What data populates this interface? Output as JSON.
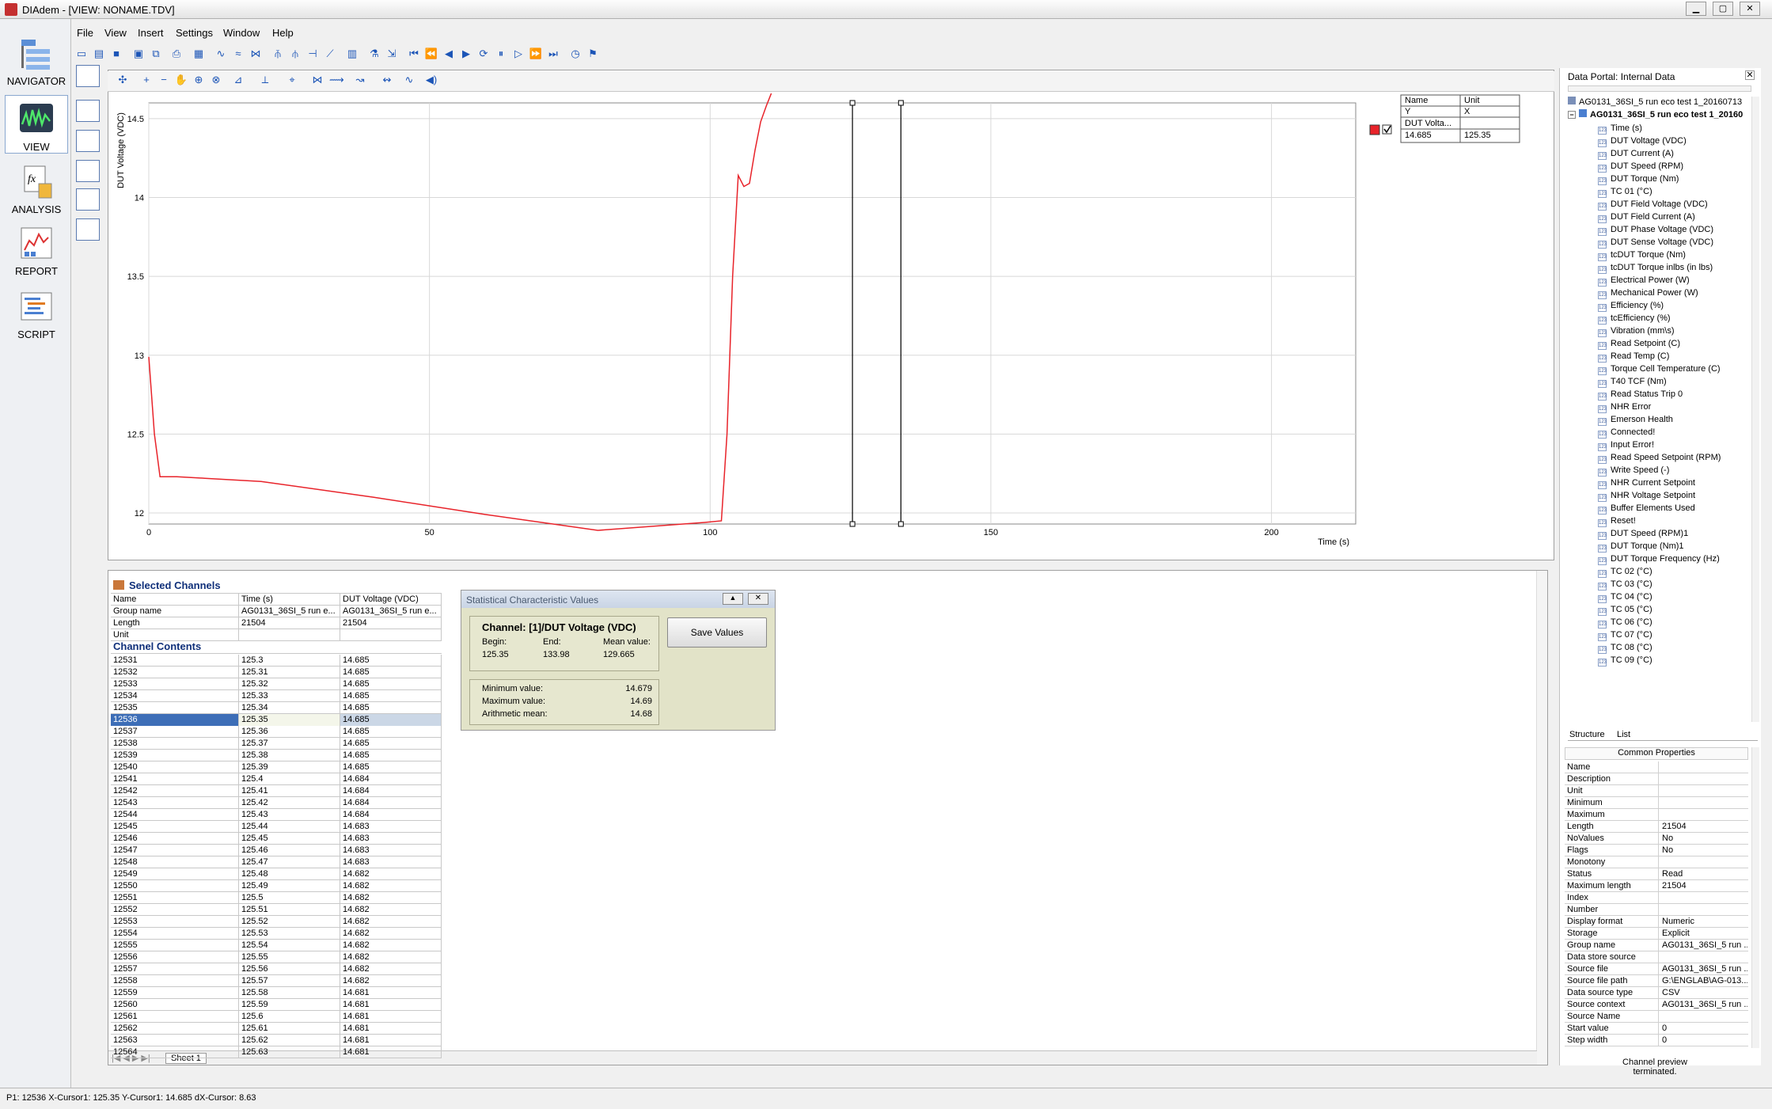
{
  "window": {
    "title": "DIAdem - [VIEW:  NONAME.TDV]",
    "buttons": {
      "minimize": "▁",
      "maximize": "▢",
      "close": "✕"
    }
  },
  "menu": [
    "File",
    "View",
    "Insert",
    "Settings",
    "Window",
    "Help"
  ],
  "nav": [
    "NAVIGATOR",
    "VIEW",
    "ANALYSIS",
    "REPORT",
    "SCRIPT"
  ],
  "colors": {
    "curve": "#e8232a",
    "cursor": "#000000",
    "selection": "#3d6eb7",
    "accent": "#1c55b7"
  },
  "chart_data": {
    "type": "line",
    "ylabel": "DUT Voltage (VDC)",
    "xlabel": "Time (s)",
    "xlim": [
      0,
      215
    ],
    "ylim": [
      11.93,
      14.6
    ],
    "x_ticks": [
      "0",
      "50",
      "100",
      "150",
      "200"
    ],
    "y_ticks": [
      "12",
      "12.5",
      "13",
      "13.5",
      "14",
      "14.5"
    ],
    "grid": true,
    "cursors": [
      125.35,
      133.98
    ],
    "series": [
      {
        "x": [
          0,
          1,
          2,
          5,
          10,
          20,
          40,
          60,
          80,
          99,
          102,
          103,
          104,
          105,
          106,
          107,
          108,
          109,
          110,
          111,
          112,
          113,
          115,
          118,
          125,
          133,
          150,
          175,
          200,
          215
        ],
        "values": [
          12.99,
          12.5,
          12.23,
          12.23,
          12.22,
          12.2,
          12.1,
          11.99,
          11.89,
          11.94,
          11.95,
          12.5,
          13.5,
          14.14,
          14.07,
          14.09,
          14.3,
          14.48,
          14.58,
          14.67,
          14.69,
          14.69,
          14.685,
          14.685,
          14.685,
          14.68,
          14.685,
          14.685,
          14.685,
          14.685
        ]
      }
    ]
  },
  "legend": {
    "headers": [
      "Name",
      "Unit"
    ],
    "axis_row": [
      "Y",
      "X"
    ],
    "channel": "DUT Volta...",
    "y_value": "14.685",
    "x_value": "125.35"
  },
  "table": {
    "title": "Selected Channels",
    "props": [
      [
        "Name",
        "Time (s)",
        "DUT Voltage (VDC)"
      ],
      [
        "Group name",
        "AG0131_36SI_5 run e...",
        "AG0131_36SI_5 run e..."
      ],
      [
        "Length",
        "21504",
        "21504"
      ],
      [
        "Unit",
        "",
        ""
      ]
    ],
    "contents_title": "Channel Contents",
    "rows": [
      [
        "12531",
        "125.3",
        "14.685"
      ],
      [
        "12532",
        "125.31",
        "14.685"
      ],
      [
        "12533",
        "125.32",
        "14.685"
      ],
      [
        "12534",
        "125.33",
        "14.685"
      ],
      [
        "12535",
        "125.34",
        "14.685"
      ],
      [
        "12536",
        "125.35",
        "14.685"
      ],
      [
        "12537",
        "125.36",
        "14.685"
      ],
      [
        "12538",
        "125.37",
        "14.685"
      ],
      [
        "12539",
        "125.38",
        "14.685"
      ],
      [
        "12540",
        "125.39",
        "14.685"
      ],
      [
        "12541",
        "125.4",
        "14.684"
      ],
      [
        "12542",
        "125.41",
        "14.684"
      ],
      [
        "12543",
        "125.42",
        "14.684"
      ],
      [
        "12544",
        "125.43",
        "14.684"
      ],
      [
        "12545",
        "125.44",
        "14.683"
      ],
      [
        "12546",
        "125.45",
        "14.683"
      ],
      [
        "12547",
        "125.46",
        "14.683"
      ],
      [
        "12548",
        "125.47",
        "14.683"
      ],
      [
        "12549",
        "125.48",
        "14.682"
      ],
      [
        "12550",
        "125.49",
        "14.682"
      ],
      [
        "12551",
        "125.5",
        "14.682"
      ],
      [
        "12552",
        "125.51",
        "14.682"
      ],
      [
        "12553",
        "125.52",
        "14.682"
      ],
      [
        "12554",
        "125.53",
        "14.682"
      ],
      [
        "12555",
        "125.54",
        "14.682"
      ],
      [
        "12556",
        "125.55",
        "14.682"
      ],
      [
        "12557",
        "125.56",
        "14.682"
      ],
      [
        "12558",
        "125.57",
        "14.682"
      ],
      [
        "12559",
        "125.58",
        "14.681"
      ],
      [
        "12560",
        "125.59",
        "14.681"
      ],
      [
        "12561",
        "125.6",
        "14.681"
      ],
      [
        "12562",
        "125.61",
        "14.681"
      ],
      [
        "12563",
        "125.62",
        "14.681"
      ],
      [
        "12564",
        "125.63",
        "14.681"
      ]
    ],
    "selected_row": 5,
    "sheet_tab": "Sheet 1"
  },
  "stats": {
    "title": "Statistical Characteristic Values",
    "channel": "Channel: [1]/DUT Voltage (VDC)",
    "begin_label": "Begin:",
    "begin": "125.35",
    "end_label": "End:",
    "end": "133.98",
    "mean_label": "Mean value:",
    "mean": "129.665",
    "save_label": "Save Values",
    "min_label": "Minimum value:",
    "min": "14.679",
    "max_label": "Maximum value:",
    "max": "14.69",
    "arith_label": "Arithmetic mean:",
    "arith": "14.68"
  },
  "portal": {
    "title": "Data Portal: Internal Data",
    "file": "AG0131_36SI_5 run eco test 1_20160713_...",
    "group": "AG0131_36SI_5 run eco test 1_20160",
    "channels": [
      "Time (s)",
      "DUT Voltage (VDC)",
      "DUT Current (A)",
      "DUT Speed (RPM)",
      "DUT Torque (Nm)",
      "TC 01 (°C)",
      "DUT Field Voltage (VDC)",
      "DUT Field Current (A)",
      "DUT Phase Voltage (VDC)",
      "DUT Sense Voltage (VDC)",
      "tcDUT Torque (Nm)",
      "tcDUT Torque inlbs (in lbs)",
      "Electrical Power (W)",
      "Mechanical Power (W)",
      "Efficiency (%)",
      "tcEfficiency (%)",
      "Vibration (mm\\s)",
      "Read Setpoint (C)",
      "Read Temp (C)",
      "Torque Cell Temperature (C)",
      "T40 TCF (Nm)",
      "Read Status Trip 0",
      "NHR Error",
      "Emerson Health",
      "Connected!",
      "Input Error!",
      "Read Speed Setpoint (RPM)",
      "Write Speed (-)",
      "NHR Current Setpoint",
      "NHR Voltage Setpoint",
      "Buffer Elements Used",
      "Reset!",
      "DUT Speed (RPM)1",
      "DUT Torque (Nm)1",
      "DUT Torque Frequency (Hz)",
      "TC 02 (°C)",
      "TC 03 (°C)",
      "TC 04 (°C)",
      "TC 05 (°C)",
      "TC 06 (°C)",
      "TC 07 (°C)",
      "TC 08 (°C)",
      "TC 09 (°C)"
    ],
    "tabs": [
      "Structure",
      "List"
    ],
    "props_title": "Common Properties",
    "props": [
      [
        "Name",
        ""
      ],
      [
        "Description",
        ""
      ],
      [
        "Unit",
        ""
      ],
      [
        "Minimum",
        ""
      ],
      [
        "Maximum",
        ""
      ],
      [
        "Length",
        "21504"
      ],
      [
        "NoValues",
        "No"
      ],
      [
        "Flags",
        "No"
      ],
      [
        "Monotony",
        ""
      ],
      [
        "Status",
        "Read"
      ],
      [
        "Maximum length",
        "21504"
      ],
      [
        "Index",
        ""
      ],
      [
        "Number",
        ""
      ],
      [
        "Display format",
        "Numeric"
      ],
      [
        "Storage",
        "Explicit"
      ],
      [
        "Group name",
        "AG0131_36SI_5 run ..."
      ],
      [
        "Data store source",
        ""
      ],
      [
        "Source file",
        "AG0131_36SI_5 run ..."
      ],
      [
        "Source file path",
        "G:\\ENGLAB\\AG-013..."
      ],
      [
        "Data source type",
        "CSV"
      ],
      [
        "Source context",
        "AG0131_36SI_5 run ..."
      ],
      [
        "Source Name",
        ""
      ],
      [
        "Start value",
        "0"
      ],
      [
        "Step width",
        "0"
      ]
    ],
    "preview_line1": "Channel preview",
    "preview_line2": "terminated."
  },
  "status": "P1: 12536 X-Cursor1: 125.35 Y-Cursor1: 14.685 dX-Cursor: 8.63"
}
